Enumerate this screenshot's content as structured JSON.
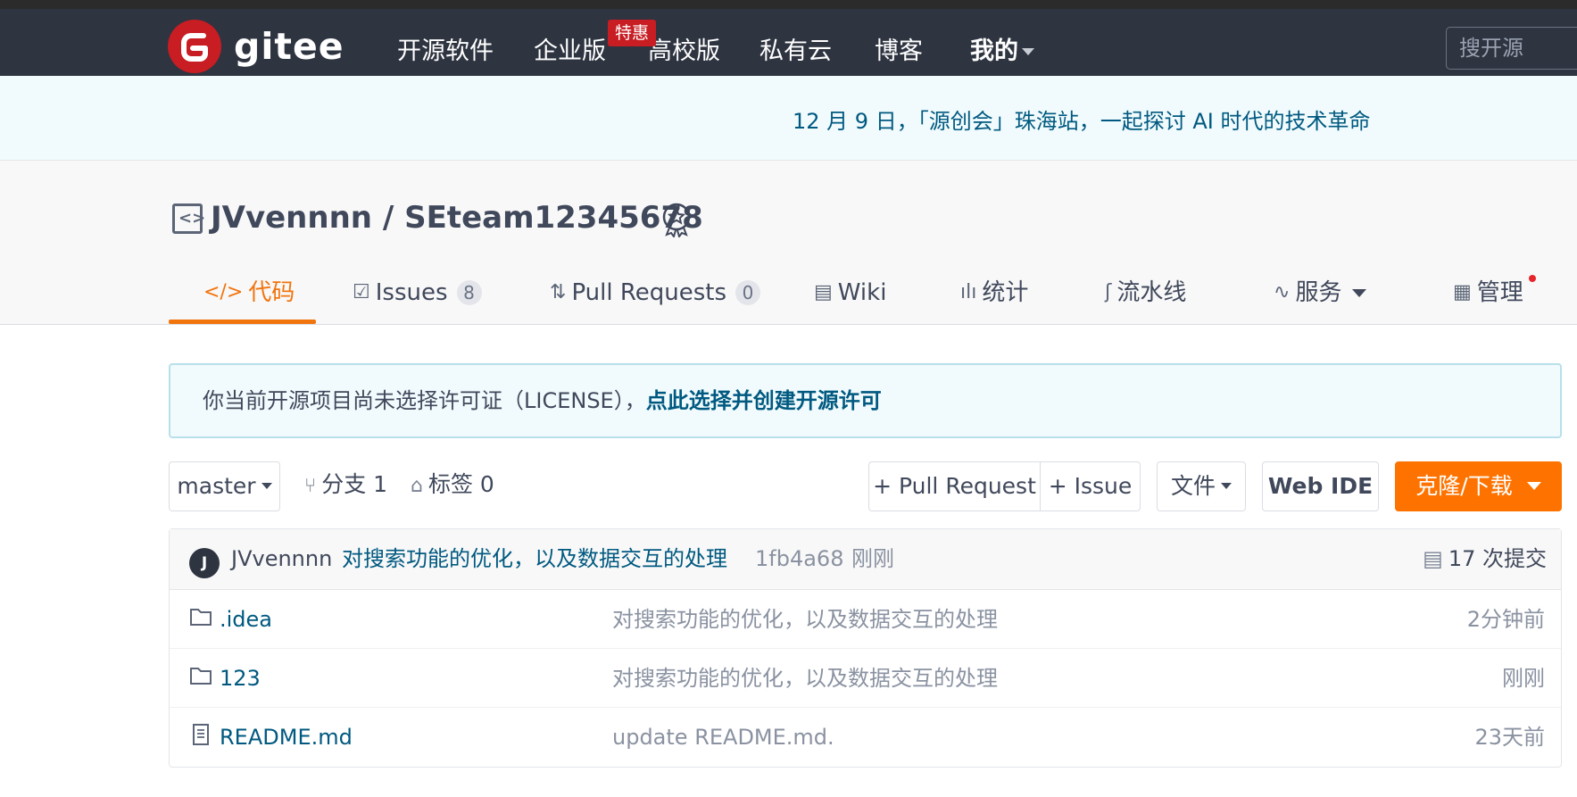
{
  "navbar": {
    "logo_text": "gitee",
    "items": [
      "开源软件",
      "企业版",
      "高校版",
      "私有云",
      "博客",
      "我的"
    ],
    "promo_badge": "特惠",
    "search_placeholder": "搜开源"
  },
  "announcement": "12 月 9 日，「源创会」珠海站，一起探讨 AI 时代的技术革命",
  "repo": {
    "title": "JVvennnn / SEteam12345678"
  },
  "tabs": [
    {
      "label": "代码",
      "icon": "code-icon"
    },
    {
      "label": "Issues",
      "count": "8",
      "icon": "issues-icon"
    },
    {
      "label": "Pull Requests",
      "count": "0",
      "icon": "pull-request-icon"
    },
    {
      "label": "Wiki",
      "icon": "wiki-icon"
    },
    {
      "label": "统计",
      "icon": "stats-icon"
    },
    {
      "label": "流水线",
      "icon": "pipeline-icon"
    },
    {
      "label": "服务",
      "icon": "service-icon"
    },
    {
      "label": "管理",
      "icon": "manage-icon"
    }
  ],
  "license_notice": {
    "text": "你当前开源项目尚未选择许可证（LICENSE），",
    "link": "点此选择并创建开源许可"
  },
  "toolbar": {
    "branch": "master",
    "branches": "分支 1",
    "tags": "标签 0",
    "pull_request": "+ Pull Request",
    "issue": "+ Issue",
    "file": "文件",
    "web_ide": "Web IDE",
    "clone": "克隆/下载"
  },
  "latest_commit": {
    "avatar_letter": "J",
    "author": "JVvennnn",
    "message": "对搜索功能的优化，以及数据交互的处理",
    "hash": "1fb4a68",
    "time": "刚刚",
    "count": "17 次提交"
  },
  "files": [
    {
      "name": ".idea",
      "type": "folder",
      "message": "对搜索功能的优化，以及数据交互的处理",
      "time": "2分钟前"
    },
    {
      "name": "123",
      "type": "folder",
      "message": "对搜索功能的优化，以及数据交互的处理",
      "time": "刚刚"
    },
    {
      "name": "README.md",
      "type": "file",
      "message": "update README.md.",
      "time": "23天前"
    }
  ],
  "colors": {
    "navbar": "#2e3440",
    "brand": "#c71d23",
    "accent": "#fe7300",
    "link": "#005980"
  }
}
